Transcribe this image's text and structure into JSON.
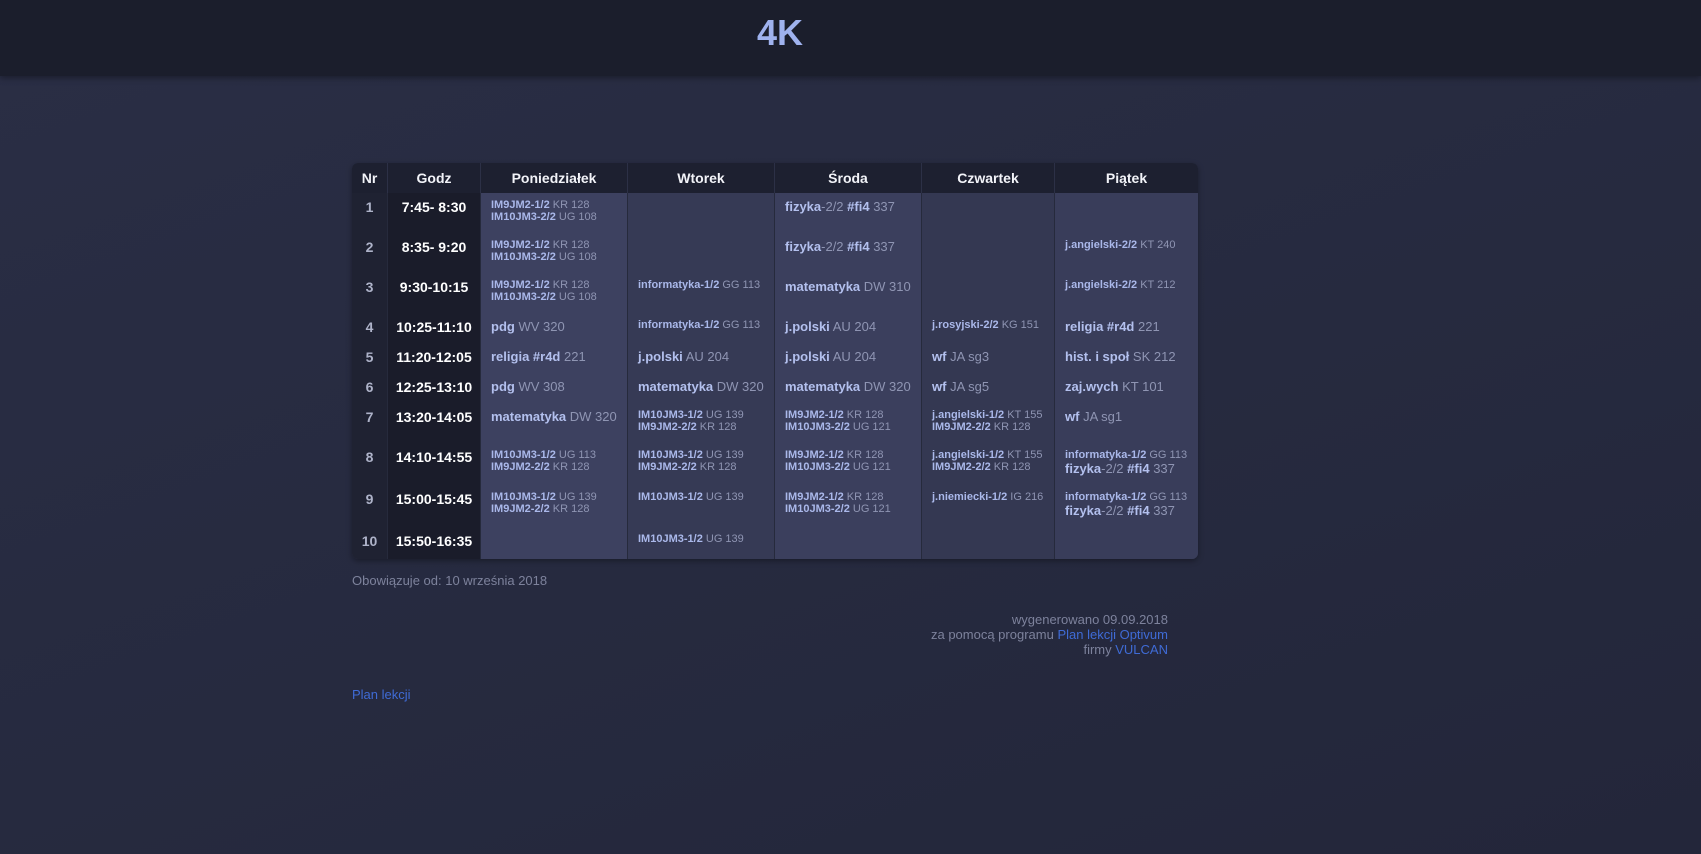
{
  "header": {
    "title": "4K"
  },
  "table": {
    "headers": [
      "Nr",
      "Godz",
      "Poniedziałek",
      "Wtorek",
      "Środa",
      "Czwartek",
      "Piątek"
    ],
    "rows": [
      {
        "nr": "1",
        "hours": "7:45- 8:30",
        "h": 40,
        "cells": [
          [
            {
              "s": "sm",
              "subj": "IM9JM2-1/2",
              "rest": "KR 128"
            },
            {
              "s": "sm",
              "subj": "IM10JM3-2/2",
              "rest": "UG 108"
            }
          ],
          [],
          [
            {
              "s": "big",
              "subj": "fizyka",
              "mid": "-2/2",
              "tag": "#fi4",
              "rest": "337"
            }
          ],
          [],
          []
        ]
      },
      {
        "nr": "2",
        "hours": "8:35- 9:20",
        "h": 40,
        "cells": [
          [
            {
              "s": "sm",
              "subj": "IM9JM2-1/2",
              "rest": "KR 128"
            },
            {
              "s": "sm",
              "subj": "IM10JM3-2/2",
              "rest": "UG 108"
            }
          ],
          [],
          [
            {
              "s": "big",
              "subj": "fizyka",
              "mid": "-2/2",
              "tag": "#fi4",
              "rest": "337"
            }
          ],
          [],
          [
            {
              "s": "sm",
              "subj": "j.angielski-2/2",
              "rest": "KT 240"
            }
          ]
        ]
      },
      {
        "nr": "3",
        "hours": "9:30-10:15",
        "h": 40,
        "cells": [
          [
            {
              "s": "sm",
              "subj": "IM9JM2-1/2",
              "rest": "KR 128"
            },
            {
              "s": "sm",
              "subj": "IM10JM3-2/2",
              "rest": "UG 108"
            }
          ],
          [
            {
              "s": "sm",
              "subj": "informatyka-1/2",
              "rest": "GG 113"
            }
          ],
          [
            {
              "s": "big",
              "subj": "matematyka",
              "rest": "DW 310"
            }
          ],
          [],
          [
            {
              "s": "sm",
              "subj": "j.angielski-2/2",
              "rest": "KT 212"
            }
          ]
        ]
      },
      {
        "nr": "4",
        "hours": "10:25-11:10",
        "h": 30,
        "cells": [
          [
            {
              "s": "big",
              "subj": "pdg",
              "rest": "WV 320"
            }
          ],
          [
            {
              "s": "sm",
              "subj": "informatyka-1/2",
              "rest": "GG 113"
            }
          ],
          [
            {
              "s": "big",
              "subj": "j.polski",
              "rest": "AU 204"
            }
          ],
          [
            {
              "s": "sm",
              "subj": "j.rosyjski-2/2",
              "rest": "KG 151"
            }
          ],
          [
            {
              "s": "big",
              "subj": "religia #r4d",
              "rest": "221"
            }
          ]
        ]
      },
      {
        "nr": "5",
        "hours": "11:20-12:05",
        "h": 30,
        "cells": [
          [
            {
              "s": "big",
              "subj": "religia #r4d",
              "rest": "221"
            }
          ],
          [
            {
              "s": "big",
              "subj": "j.polski",
              "rest": "AU 204"
            }
          ],
          [
            {
              "s": "big",
              "subj": "j.polski",
              "rest": "AU 204"
            }
          ],
          [
            {
              "s": "big",
              "subj": "wf",
              "rest": "JA sg3"
            }
          ],
          [
            {
              "s": "big",
              "subj": "hist. i społ",
              "rest": "SK 212"
            }
          ]
        ]
      },
      {
        "nr": "6",
        "hours": "12:25-13:10",
        "h": 30,
        "cells": [
          [
            {
              "s": "big",
              "subj": "pdg",
              "rest": "WV 308"
            }
          ],
          [
            {
              "s": "big",
              "subj": "matematyka",
              "rest": "DW 320"
            }
          ],
          [
            {
              "s": "big",
              "subj": "matematyka",
              "rest": "DW 320"
            }
          ],
          [
            {
              "s": "big",
              "subj": "wf",
              "rest": "JA sg5"
            }
          ],
          [
            {
              "s": "big",
              "subj": "zaj.wych",
              "rest": "KT 101"
            }
          ]
        ]
      },
      {
        "nr": "7",
        "hours": "13:20-14:05",
        "h": 40,
        "cells": [
          [
            {
              "s": "big",
              "subj": "matematyka",
              "rest": "DW 320"
            }
          ],
          [
            {
              "s": "sm",
              "subj": "IM10JM3-1/2",
              "rest": "UG 139"
            },
            {
              "s": "sm",
              "subj": "IM9JM2-2/2",
              "rest": "KR 128"
            }
          ],
          [
            {
              "s": "sm",
              "subj": "IM9JM2-1/2",
              "rest": "KR 128"
            },
            {
              "s": "sm",
              "subj": "IM10JM3-2/2",
              "rest": "UG 121"
            }
          ],
          [
            {
              "s": "sm",
              "subj": "j.angielski-1/2",
              "rest": "KT 155"
            },
            {
              "s": "sm",
              "subj": "IM9JM2-2/2",
              "rest": "KR 128"
            }
          ],
          [
            {
              "s": "big",
              "subj": "wf",
              "rest": "JA sg1"
            }
          ]
        ]
      },
      {
        "nr": "8",
        "hours": "14:10-14:55",
        "h": 42,
        "cells": [
          [
            {
              "s": "sm",
              "subj": "IM10JM3-1/2",
              "rest": "UG 113"
            },
            {
              "s": "sm",
              "subj": "IM9JM2-2/2",
              "rest": "KR 128"
            }
          ],
          [
            {
              "s": "sm",
              "subj": "IM10JM3-1/2",
              "rest": "UG 139"
            },
            {
              "s": "sm",
              "subj": "IM9JM2-2/2",
              "rest": "KR 128"
            }
          ],
          [
            {
              "s": "sm",
              "subj": "IM9JM2-1/2",
              "rest": "KR 128"
            },
            {
              "s": "sm",
              "subj": "IM10JM3-2/2",
              "rest": "UG 121"
            }
          ],
          [
            {
              "s": "sm",
              "subj": "j.angielski-1/2",
              "rest": "KT 155"
            },
            {
              "s": "sm",
              "subj": "IM9JM2-2/2",
              "rest": "KR 128"
            }
          ],
          [
            {
              "s": "sm",
              "subj": "informatyka-1/2",
              "rest": "GG 113"
            },
            {
              "s": "big",
              "subj": "fizyka",
              "mid": "-2/2",
              "tag": "#fi4",
              "rest": "337"
            }
          ]
        ]
      },
      {
        "nr": "9",
        "hours": "15:00-15:45",
        "h": 42,
        "cells": [
          [
            {
              "s": "sm",
              "subj": "IM10JM3-1/2",
              "rest": "UG 139"
            },
            {
              "s": "sm",
              "subj": "IM9JM2-2/2",
              "rest": "KR 128"
            }
          ],
          [
            {
              "s": "sm",
              "subj": "IM10JM3-1/2",
              "rest": "UG 139"
            }
          ],
          [
            {
              "s": "sm",
              "subj": "IM9JM2-1/2",
              "rest": "KR 128"
            },
            {
              "s": "sm",
              "subj": "IM10JM3-2/2",
              "rest": "UG 121"
            }
          ],
          [
            {
              "s": "sm",
              "subj": "j.niemiecki-1/2",
              "rest": "IG 216"
            }
          ],
          [
            {
              "s": "sm",
              "subj": "informatyka-1/2",
              "rest": "GG 113"
            },
            {
              "s": "big",
              "subj": "fizyka",
              "mid": "-2/2",
              "tag": "#fi4",
              "rest": "337"
            }
          ]
        ]
      },
      {
        "nr": "10",
        "hours": "15:50-16:35",
        "h": 32,
        "cells": [
          [],
          [
            {
              "s": "sm",
              "subj": "IM10JM3-1/2",
              "rest": "UG 139"
            }
          ],
          [],
          [],
          []
        ]
      }
    ]
  },
  "footer": {
    "valid_from": "Obowiązuje od: 10 września 2018",
    "generated": "wygenerowano 09.09.2018",
    "with_program": "za pomocą programu",
    "program_link": "Plan lekcji Optivum",
    "company_prefix": "firmy",
    "company_link": "VULCAN",
    "plan_link": "Plan lekcji"
  }
}
